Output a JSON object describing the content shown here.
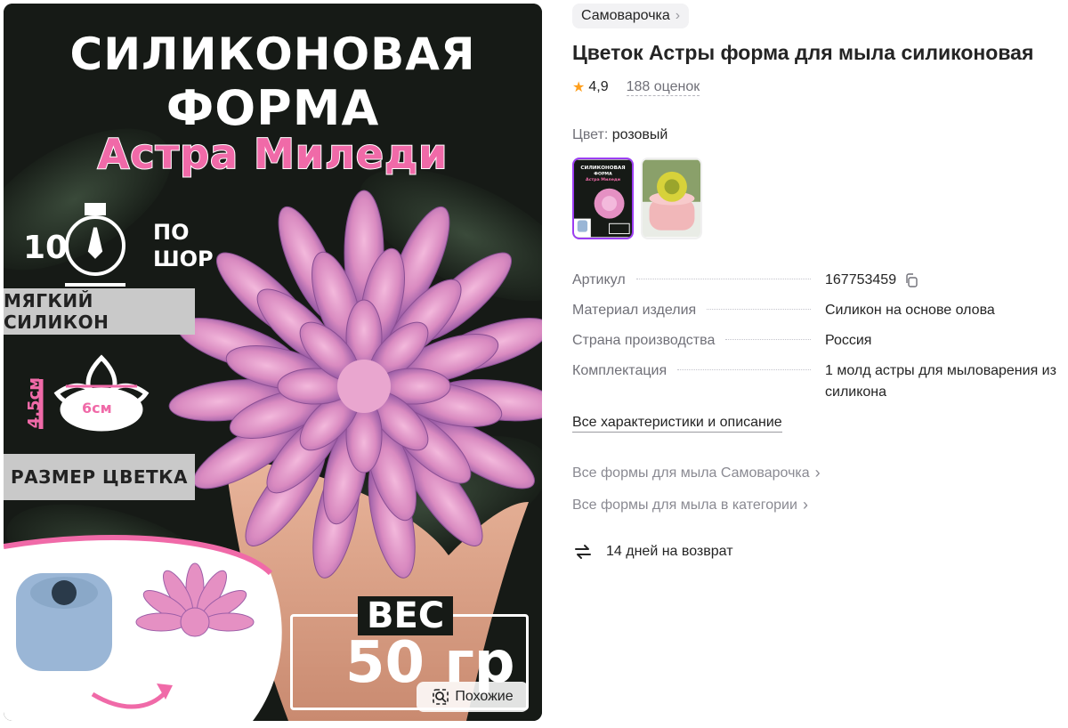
{
  "gallery": {
    "image_text": {
      "title_line1": "СИЛИКОНОВАЯ",
      "title_line2": "ФОРМА",
      "title_line3": "Астра Миледи",
      "hardness_value": "10",
      "hardness_unit": "ПО ШОР",
      "band_soft": "МЯГКИЙ СИЛИКОН",
      "height": "4,5см",
      "width": "6см",
      "band_size": "РАЗМЕР ЦВЕТКА",
      "weight_label": "ВЕС",
      "weight_value": "50 гр"
    },
    "similar_button": "Похожие"
  },
  "brand": {
    "name": "Самоварочка"
  },
  "product": {
    "title": "Цветок Астры форма для мыла силиконовая",
    "rating": "4,9",
    "reviews": "188 оценок"
  },
  "color": {
    "label": "Цвет:",
    "value": "розовый"
  },
  "specs": [
    {
      "name": "Артикул",
      "value": "167753459"
    },
    {
      "name": "Материал изделия",
      "value": "Силикон на основе олова"
    },
    {
      "name": "Страна производства",
      "value": "Россия"
    },
    {
      "name": "Комплектация",
      "value": "1 молд астры для мыловарения из силикона"
    }
  ],
  "links": {
    "all_specs": "Все характеристики и описание",
    "brand_forms": "Все формы для мыла Самоварочка",
    "category_forms": "Все формы для мыла в категории"
  },
  "returns": {
    "text": "14 дней на возврат"
  },
  "colors": {
    "accent_purple": "#9b3df2",
    "star": "#ff9f1c",
    "muted_text": "#707078",
    "petal_pink": "#e58fc3",
    "title_pink": "#f06aa8"
  }
}
